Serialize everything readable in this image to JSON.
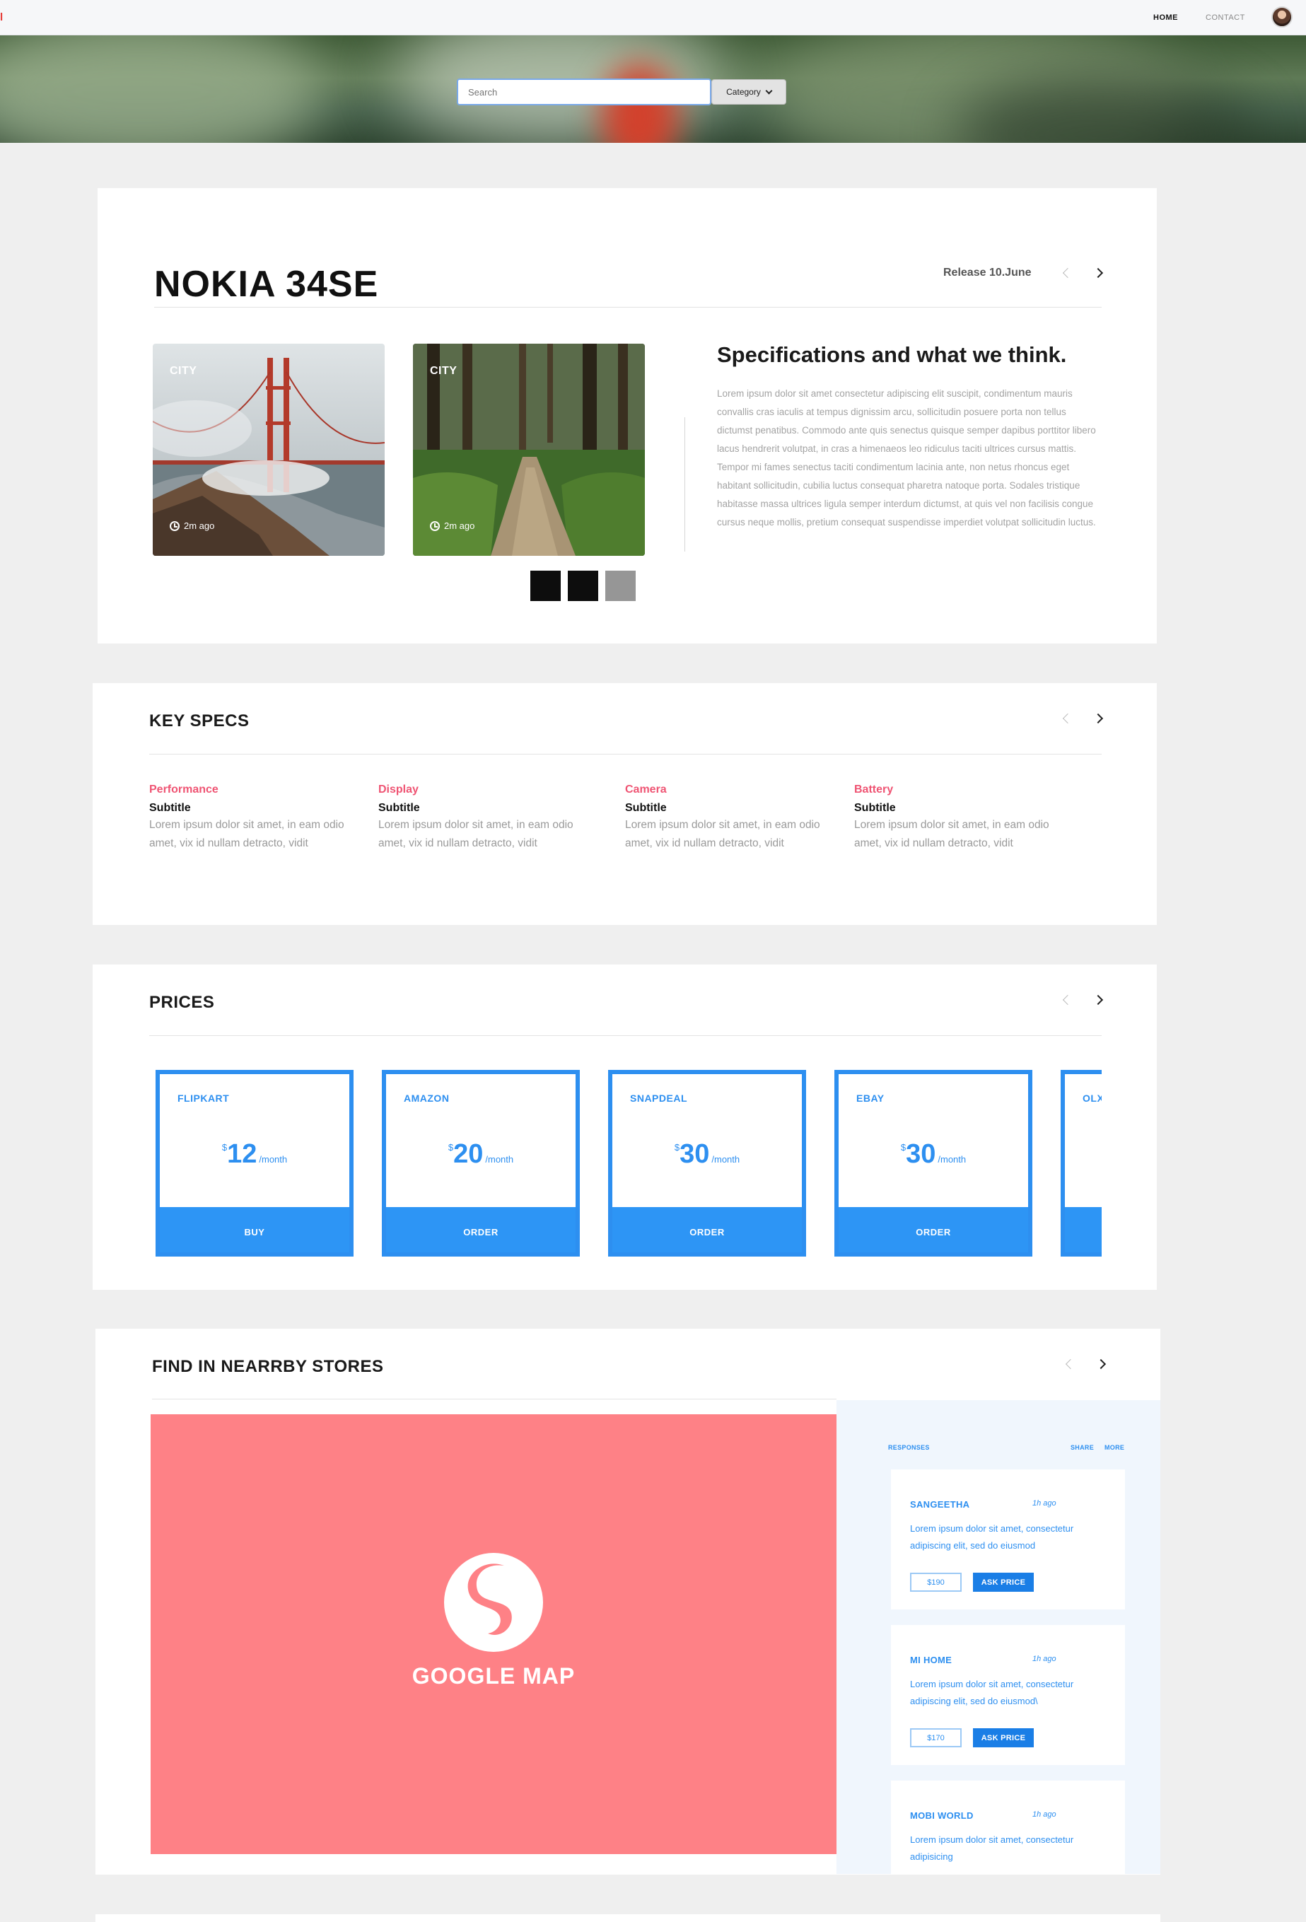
{
  "nav": {
    "brand": "l",
    "home": "HOME",
    "contact": "CONTACT"
  },
  "hero": {
    "search_placeholder": "Search",
    "category": "Category"
  },
  "product": {
    "title": "NOKIA 34SE",
    "release": "Release 10.June",
    "photos": [
      {
        "tag": "CITY",
        "time": "2m ago"
      },
      {
        "tag": "CITY",
        "time": "2m ago"
      }
    ],
    "swatches": [
      "#0d0d0d",
      "#0d0d0d",
      "#969696"
    ],
    "spec_heading": "Specifications and what we think.",
    "spec_text": "Lorem ipsum dolor sit amet consectetur adipiscing elit suscipit, condimentum mauris convallis cras iaculis at tempus dignissim arcu, sollicitudin posuere porta non tellus dictumst penatibus. Commodo ante quis senectus quisque semper dapibus porttitor libero lacus hendrerit volutpat, in cras a himenaeos leo ridiculus taciti ultrices cursus mattis. Tempor mi fames senectus taciti condimentum lacinia ante, non netus rhoncus eget habitant sollicitudin, cubilia luctus consequat pharetra natoque porta. Sodales tristique habitasse massa ultrices ligula semper interdum dictumst, at quis vel non facilisis congue cursus neque mollis, pretium consequat suspendisse imperdiet volutpat sollicitudin luctus."
  },
  "key_specs": {
    "title": "KEY SPECS",
    "items": [
      {
        "label": "Performance",
        "subtitle": "Subtitle",
        "text": "Lorem ipsum dolor sit amet, in eam odio amet, vix id nullam detracto, vidit"
      },
      {
        "label": "Display",
        "subtitle": "Subtitle",
        "text": "Lorem ipsum dolor sit amet, in eam odio amet, vix id nullam detracto, vidit"
      },
      {
        "label": "Camera",
        "subtitle": "Subtitle",
        "text": "Lorem ipsum dolor sit amet, in eam odio amet, vix id nullam detracto, vidit"
      },
      {
        "label": "Battery",
        "subtitle": "Subtitle",
        "text": "Lorem ipsum dolor sit amet, in eam odio amet, vix id nullam detracto, vidit"
      }
    ]
  },
  "prices": {
    "title": "PRICES",
    "items": [
      {
        "vendor": "FLIPKART",
        "currency": "$",
        "amount": "12",
        "period": "/month",
        "action": "BUY"
      },
      {
        "vendor": "AMAZON",
        "currency": "$",
        "amount": "20",
        "period": "/month",
        "action": "ORDER"
      },
      {
        "vendor": "SNAPDEAL",
        "currency": "$",
        "amount": "30",
        "period": "/month",
        "action": "ORDER"
      },
      {
        "vendor": "EBAY",
        "currency": "$",
        "amount": "30",
        "period": "/month",
        "action": "ORDER"
      },
      {
        "vendor": "OLX"
      }
    ]
  },
  "stores": {
    "title": "FIND IN NEARRBY STORES",
    "map_label": "GOOGLE MAP",
    "responses_label": "RESPONSES",
    "share_label": "SHARE",
    "more_label": "MORE",
    "responses": [
      {
        "name": "SANGEETHA",
        "ago": "1h ago",
        "text": "Lorem ipsum dolor sit amet, consectetur adipiscing elit, sed do eiusmod",
        "price": "$190",
        "action": "ASK PRICE"
      },
      {
        "name": "MI HOME",
        "ago": "1h ago",
        "text": "Lorem ipsum dolor sit amet, consectetur adipiscing elit, sed do eiusmod\\",
        "price": "$170",
        "action": "ASK PRICE"
      },
      {
        "name": "MOBI WORLD",
        "ago": "1h ago",
        "text": "Lorem ipsum dolor sit amet, consectetur adipisicing"
      }
    ]
  },
  "colors": {
    "accent": "#2d8ff0",
    "spec_label": "#ef5473",
    "map": "#fe8186",
    "brand": "#e53935"
  }
}
